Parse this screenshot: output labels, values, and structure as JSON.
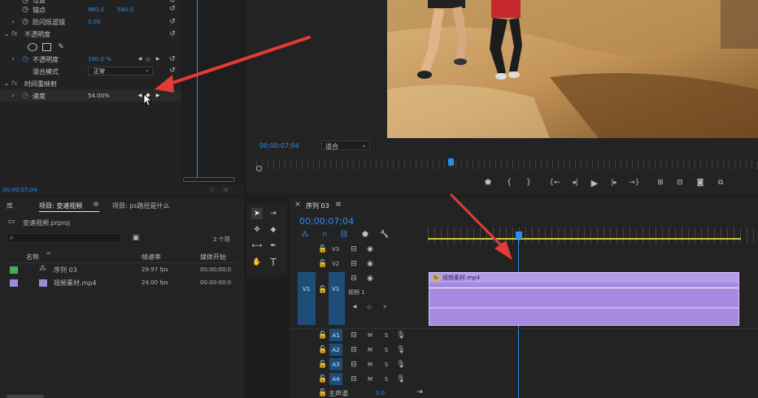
{
  "effect_controls": {
    "rows": [
      {
        "label": "位置",
        "x": "",
        "y": ""
      },
      {
        "label": "锚点",
        "x": "960.0",
        "y": "540.0"
      },
      {
        "label": "防闪烁滤镜",
        "x": "0.00",
        "y": ""
      },
      {
        "label": "不透明度",
        "x": "",
        "y": ""
      },
      {
        "label": "不透明度",
        "x": "100.0 %",
        "y": ""
      },
      {
        "label": "混合模式",
        "x": "正常",
        "y": ""
      },
      {
        "label": "时间重映射",
        "x": "",
        "y": ""
      },
      {
        "label": "速度",
        "x": "54.00%",
        "y": ""
      }
    ],
    "fx_label": "fx",
    "timecode": "00;00;07;04"
  },
  "program_monitor": {
    "timecode": "00;00;07;04",
    "fit_label": "适合",
    "controls": [
      "marker-icon",
      "in-point-icon",
      "out-point-icon",
      "go-to-in-icon",
      "step-back-icon",
      "play-icon",
      "step-forward-icon",
      "go-to-out-icon",
      "lift-icon",
      "extract-icon",
      "export-frame-icon",
      "compare-icon"
    ]
  },
  "project_panel": {
    "tab_library": "库",
    "tab_project": "项目: 变速视频",
    "tab_project2": "项目: ps路径是什么",
    "project_file": "变速视频.prproj",
    "item_count": "2 个项",
    "col_name": "名称",
    "col_fps": "帧速率",
    "col_start": "媒体开始",
    "items": [
      {
        "name": "序列 03",
        "fps": "29.97 fps",
        "start": "00;00;00;0",
        "color": "#3fb34f"
      },
      {
        "name": "视频素材.mp4",
        "fps": "24.00 fps",
        "start": "00:00:00:0",
        "color": "#a08ad8"
      }
    ]
  },
  "timeline": {
    "tab": "序列 03",
    "timecode": "00;00;07;04",
    "video_tracks": [
      {
        "name": "V3"
      },
      {
        "name": "V2"
      },
      {
        "name": "V1",
        "label": "视频 1"
      }
    ],
    "audio_tracks": [
      {
        "name": "A1",
        "m": "M",
        "s": "S"
      },
      {
        "name": "A2",
        "m": "M",
        "s": "S"
      },
      {
        "name": "A3",
        "m": "M",
        "s": "S"
      },
      {
        "name": "A4",
        "m": "M",
        "s": "S"
      }
    ],
    "master_label": "主声道",
    "master_value": "0.0",
    "clip_label": "视频素材.mp4",
    "source_patch": "V1",
    "clip_color": "#a68ae0"
  },
  "colors": {
    "accent": "#2d8ceb",
    "annotation": "#e33b36",
    "clip": "#a68ae0"
  }
}
